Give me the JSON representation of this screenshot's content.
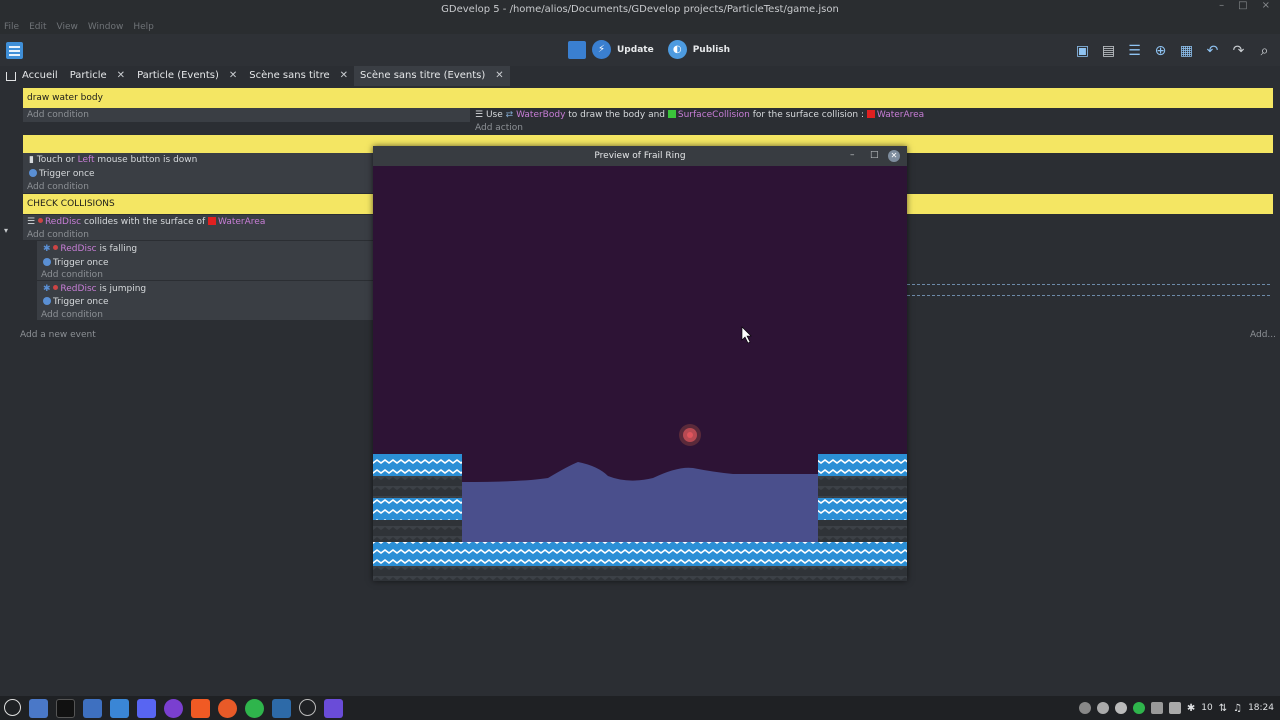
{
  "window": {
    "title": "GDevelop 5 - /home/alios/Documents/GDevelop projects/ParticleTest/game.json",
    "controls": [
      "–",
      "□",
      "×"
    ]
  },
  "menu": [
    "File",
    "Edit",
    "View",
    "Window",
    "Help"
  ],
  "toolbar": {
    "update_label": "Update",
    "publish_label": "Publish",
    "right_icons": [
      "add-scene-icon",
      "window-icon",
      "list-icon",
      "plus-icon",
      "grid-icon",
      "undo-icon",
      "redo-icon",
      "search-icon"
    ]
  },
  "tabs": [
    {
      "label": "Accueil",
      "active": false
    },
    {
      "label": "Particle",
      "active": false
    },
    {
      "label": "Particle (Events)",
      "active": false
    },
    {
      "label": "Scène sans titre",
      "active": false
    },
    {
      "label": "Scène sans titre (Events)",
      "active": true
    }
  ],
  "events": {
    "comment1": "draw water body",
    "add_condition": "Add condition",
    "add_action": "Add action",
    "action1": {
      "use": "Use",
      "obj1": "WaterBody",
      "mid": "to draw the body and",
      "obj2": "SurfaceCollision",
      "mid2": "for the surface collision :",
      "obj3": "WaterArea"
    },
    "touch": {
      "prefix": "Touch or",
      "highlight": "Left",
      "suffix": "mouse button is down"
    },
    "trigger_once": "Trigger once",
    "group_title": "CHECK COLLISIONS",
    "collide": {
      "obj": "RedDisc",
      "mid": "collides with the surface of",
      "obj2": "WaterArea"
    },
    "falling": {
      "obj": "RedDisc",
      "text": "is falling"
    },
    "jumping": {
      "obj": "RedDisc",
      "text": "is jumping"
    },
    "add_new_event": "Add a new event",
    "add_right": "Add..."
  },
  "preview": {
    "title": "Preview of Frail Ring"
  },
  "taskbar": {
    "keyboard": "10",
    "time": "18:24"
  },
  "colors": {
    "accent": "#3a7fd0",
    "comment_yellow": "#f4e663",
    "object_purple": "#c77dd6",
    "game_background": "#2d1335",
    "water_body": "#4a4f8c",
    "platform_blue": "#2b8fd6"
  }
}
